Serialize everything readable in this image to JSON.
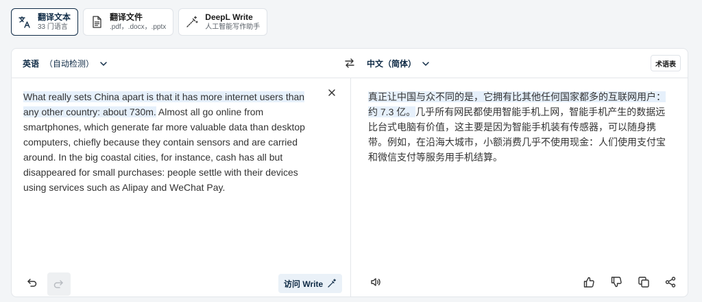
{
  "tabs": [
    {
      "label": "翻译文本",
      "sub": "33 门语言",
      "icon": "translate-icon"
    },
    {
      "label": "翻译文件",
      "sub": ".pdf，.docx，.pptx",
      "icon": "document-icon"
    },
    {
      "label": "DeepL Write",
      "sub": "人工智能写作助手",
      "icon": "magic-wand-icon"
    }
  ],
  "source": {
    "language": "英语",
    "detect": "（自动检测）",
    "text_highlighted": "What really sets China apart is that it has more internet users than any other country: about 730m.",
    "text_rest": " Almost all go online from smartphones, which generate far more valuable data than desktop computers, chiefly because they contain sensors and are carried around. In the big coastal cities, for instance, cash has all but disappeared for small purchases: people settle with their devices using services such as Alipay and WeChat Pay.",
    "visit_write_label": "访问 Write"
  },
  "target": {
    "language": "中文（简体）",
    "glossary_label": "术语表",
    "text_highlighted": "真正让中国与众不同的是，它拥有比其他任何国家都多的互联网用户：约 7.3 亿。",
    "text_rest": "几乎所有网民都使用智能手机上网，智能手机产生的数据远比台式电脑有价值，这主要是因为智能手机装有传感器，可以随身携带。例如，在沿海大城市，小额消费几乎不使用现金：人们使用支付宝和微信支付等服务用手机结算。"
  },
  "colors": {
    "accent": "#0f2b46",
    "highlight": "#e6f0fb",
    "background": "#f3f5f7"
  }
}
